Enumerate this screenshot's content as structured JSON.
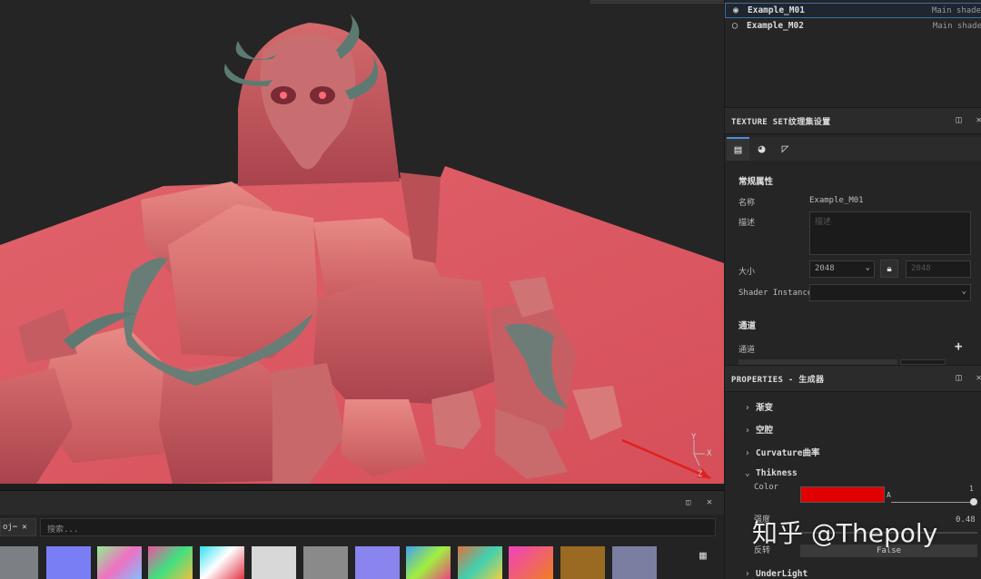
{
  "layers": [
    {
      "name": "Example_M01",
      "sub": "Main shade",
      "selected": true
    },
    {
      "name": "Example_M02",
      "sub": "Main shade",
      "selected": false
    }
  ],
  "texture_panel": {
    "title": "TEXTURE SET纹理集设置",
    "section_common": "常规属性",
    "name_label": "名称",
    "name_value": "Example_M01",
    "desc_label": "描述",
    "desc_placeholder": "描述",
    "size_label": "大小",
    "size_value": "2048",
    "size_value2": "2048",
    "shader_label": "Shader Instance",
    "channels_header": "通道",
    "channels_label": "通道",
    "add_icon": "+"
  },
  "properties_panel": {
    "title": "PROPERTIES - 生成器",
    "items": [
      {
        "label": "渐变",
        "expanded": false
      },
      {
        "label": "空腔",
        "expanded": false
      },
      {
        "label": "Curvature曲率",
        "expanded": false
      },
      {
        "label": "Thikness",
        "expanded": true
      },
      {
        "label": "UnderLight",
        "expanded": false
      }
    ],
    "color_label": "Color",
    "color_value": "#e00000",
    "alpha_label": "A",
    "alpha_value": "1",
    "strength_label": "强度",
    "strength_value": "0.48",
    "invert_label": "反转",
    "invert_value": "False"
  },
  "shelf": {
    "chip_label": "oj⋯",
    "search_placeholder": "搜索..."
  },
  "viewport_gizmo": {
    "y": "Y",
    "x": "X",
    "z": "Z"
  },
  "watermark": "知乎 @Thepoly"
}
